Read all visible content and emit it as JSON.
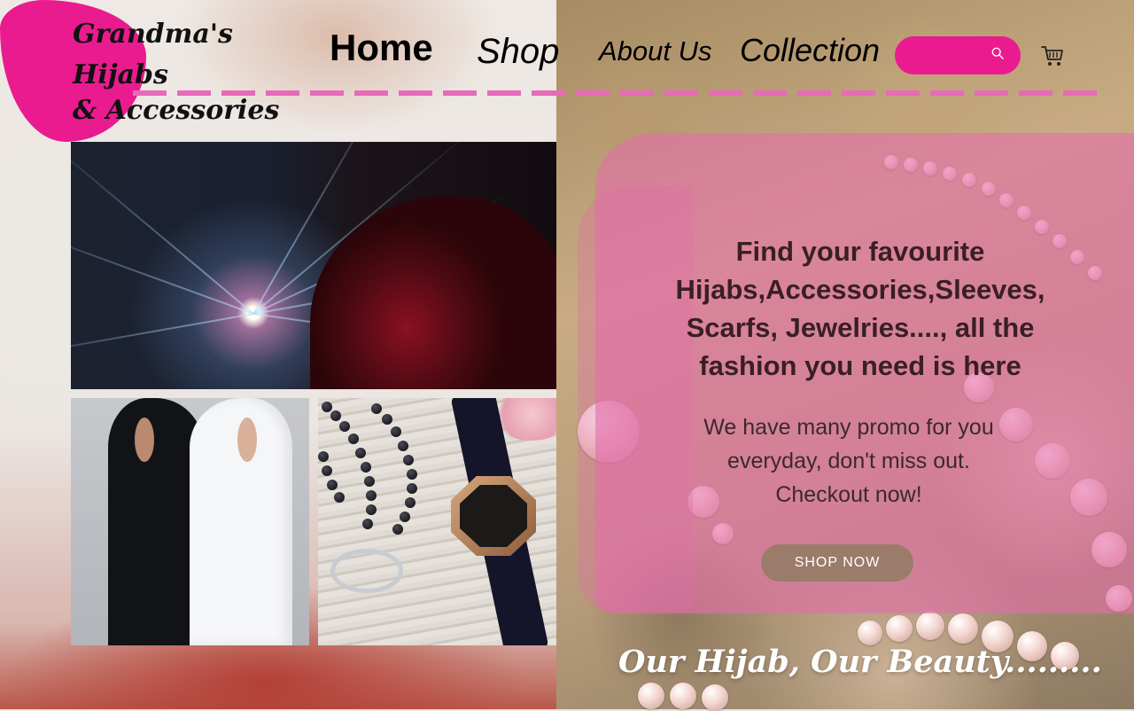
{
  "brand": {
    "line1": "Grandma's Hijabs",
    "line2": "& Accessories",
    "color": "#ea1b8f"
  },
  "nav": {
    "items": [
      {
        "label": "Home",
        "active": true
      },
      {
        "label": "Shop"
      },
      {
        "label": "About Us"
      },
      {
        "label": "Collection"
      }
    ]
  },
  "search": {
    "placeholder": "",
    "icon": "search-icon"
  },
  "cart": {
    "icon": "cart-icon"
  },
  "hero": {
    "headline": "Find your favourite Hijabs,Accessories,Sleeves, Scarfs, Jewelries...., all the fashion you need is here",
    "subtext": "We have many promo for you everyday, don't miss out. Checkout now!",
    "cta": "SHOP NOW",
    "cta_color": "#9b7b6a"
  },
  "tagline": "Our Hijab, Our Beauty.........",
  "colors": {
    "accent_pink": "#ea1b8f",
    "dash_pink": "#e66bb9",
    "overlay_pink": "#e36eaa",
    "headline": "#3a1f24"
  }
}
